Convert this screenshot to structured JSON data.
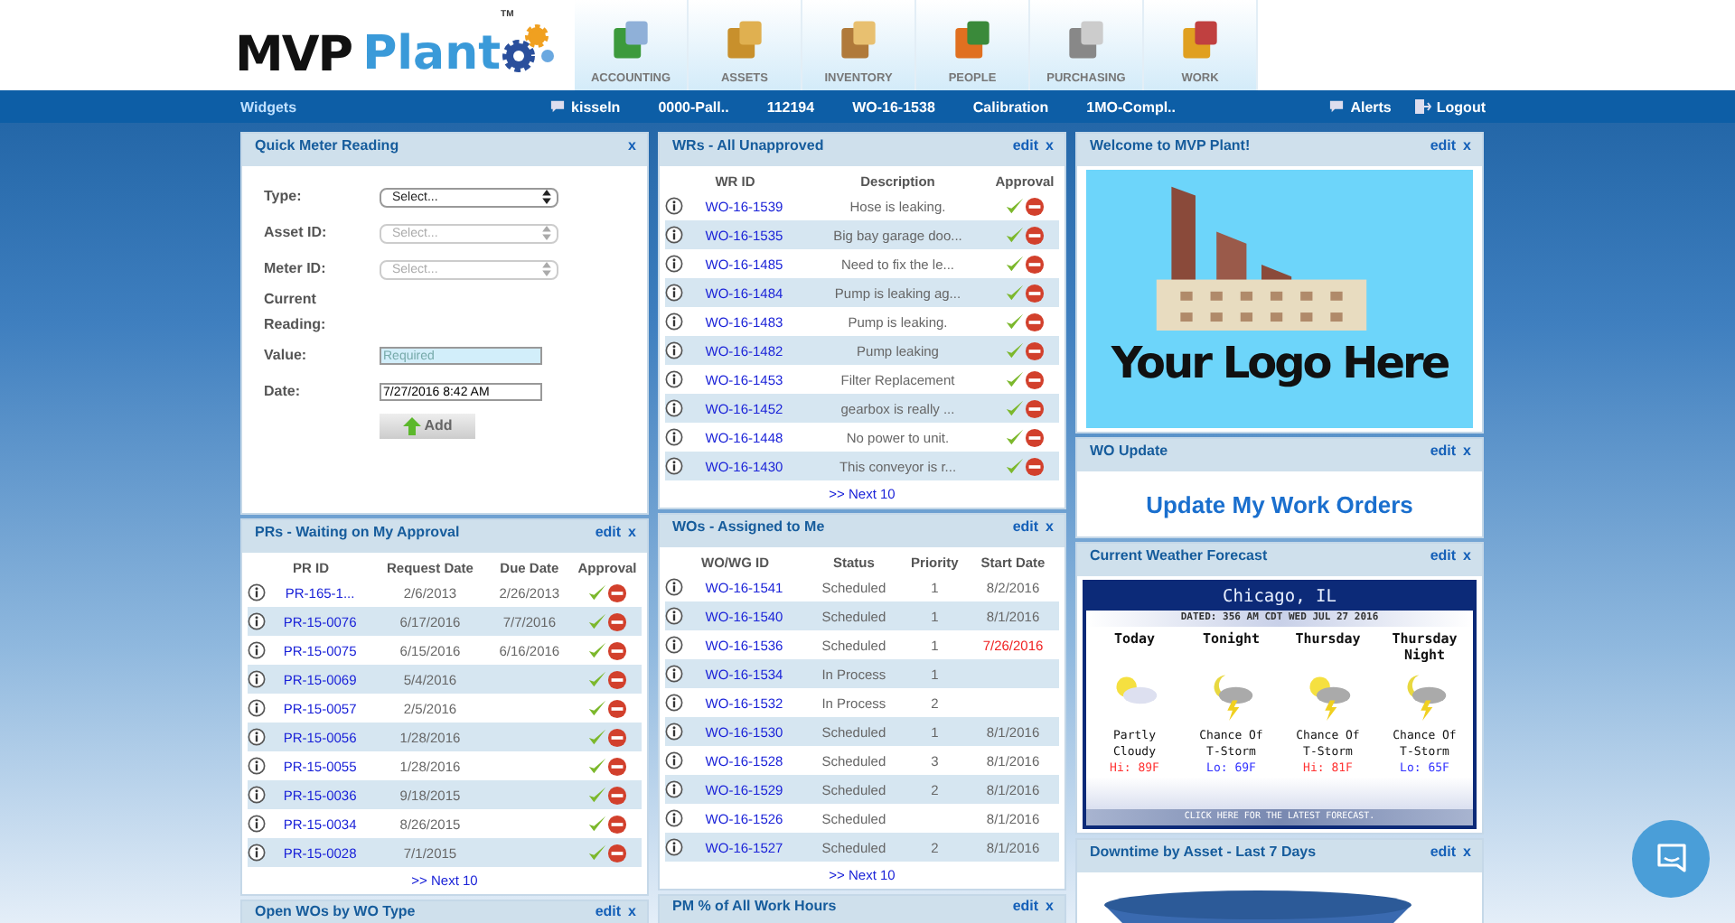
{
  "logo": {
    "word_1": "MVP",
    "word_2": "Plant",
    "tm": "TM"
  },
  "nav_tabs": [
    {
      "label": "ACCOUNTING"
    },
    {
      "label": "ASSETS"
    },
    {
      "label": "INVENTORY"
    },
    {
      "label": "PEOPLE"
    },
    {
      "label": "PURCHASING"
    },
    {
      "label": "WORK"
    }
  ],
  "toolbar": {
    "widgets": "Widgets",
    "user": "kisseln",
    "items": [
      "0000-Pall..",
      "112194",
      "WO-16-1538",
      "Calibration",
      "1MO-Compl.."
    ],
    "alerts": "Alerts",
    "logout": "Logout"
  },
  "columns": [
    [
      {
        "kind": "meter_form",
        "title": "Quick Meter Reading",
        "close": "x",
        "fields": [
          {
            "label": "Type:",
            "kind": "select",
            "value": "Select...",
            "disabled": false
          },
          {
            "label": "Asset ID:",
            "kind": "select",
            "value": "Select...",
            "disabled": true
          },
          {
            "label": "Meter ID:",
            "kind": "select",
            "value": "Select...",
            "disabled": true
          },
          {
            "label": "Current Reading:",
            "kind": "label"
          },
          {
            "label": "Value:",
            "kind": "input",
            "placeholder": "Required"
          },
          {
            "label": "Date:",
            "kind": "input",
            "value": "7/27/2016 8:42 AM"
          }
        ],
        "button": "Add"
      },
      {
        "kind": "approval_table",
        "title": "PRs - Waiting on My Approval",
        "edit": "edit",
        "close": "x",
        "columns": [
          "PR ID",
          "Request Date",
          "Due Date",
          "Approval"
        ],
        "rows": [
          {
            "cells": [
              "PR-165-1...",
              "2/6/2013",
              "2/26/2013"
            ]
          },
          {
            "cells": [
              "PR-15-0076",
              "6/17/2016",
              "7/7/2016"
            ]
          },
          {
            "cells": [
              "PR-15-0075",
              "6/15/2016",
              "6/16/2016"
            ]
          },
          {
            "cells": [
              "PR-15-0069",
              "5/4/2016",
              null
            ]
          },
          {
            "cells": [
              "PR-15-0057",
              "2/5/2016",
              null
            ]
          },
          {
            "cells": [
              "PR-15-0056",
              "1/28/2016",
              null
            ]
          },
          {
            "cells": [
              "PR-15-0055",
              "1/28/2016",
              null
            ]
          },
          {
            "cells": [
              "PR-15-0036",
              "9/18/2015",
              null
            ]
          },
          {
            "cells": [
              "PR-15-0034",
              "8/26/2015",
              null
            ]
          },
          {
            "cells": [
              "PR-15-0028",
              "7/1/2015",
              null
            ]
          }
        ],
        "next": ">> Next 10"
      },
      {
        "kind": "header",
        "title": "Open WOs by WO Type",
        "edit": "edit",
        "close": "x"
      }
    ],
    [
      {
        "kind": "approval_table",
        "title": "WRs - All Unapproved",
        "edit": "edit",
        "close": "x",
        "columns": [
          "WR ID",
          "Description",
          "Approval"
        ],
        "rows": [
          {
            "cells": [
              "WO-16-1539",
              "Hose is leaking."
            ]
          },
          {
            "cells": [
              "WO-16-1535",
              "Big bay garage doo..."
            ]
          },
          {
            "cells": [
              "WO-16-1485",
              "Need to fix the le..."
            ]
          },
          {
            "cells": [
              "WO-16-1484",
              "Pump is leaking ag..."
            ]
          },
          {
            "cells": [
              "WO-16-1483",
              "Pump is leaking."
            ]
          },
          {
            "cells": [
              "WO-16-1482",
              "Pump leaking"
            ]
          },
          {
            "cells": [
              "WO-16-1453",
              "Filter Replacement"
            ]
          },
          {
            "cells": [
              "WO-16-1452",
              "gearbox is really ..."
            ]
          },
          {
            "cells": [
              "WO-16-1448",
              "No power to unit."
            ]
          },
          {
            "cells": [
              "WO-16-1430",
              "This conveyor is r..."
            ]
          }
        ],
        "next": ">> Next 10"
      },
      {
        "kind": "table",
        "title": "WOs - Assigned to Me",
        "edit": "edit",
        "close": "x",
        "columns": [
          "WO/WG ID",
          "Status",
          "Priority",
          "Start Date"
        ],
        "rows": [
          {
            "cells": [
              "WO-16-1541",
              "Scheduled",
              "1",
              "8/2/2016"
            ],
            "overdue": false
          },
          {
            "cells": [
              "WO-16-1540",
              "Scheduled",
              "1",
              "8/1/2016"
            ],
            "overdue": false
          },
          {
            "cells": [
              "WO-16-1536",
              "Scheduled",
              "1",
              "7/26/2016"
            ],
            "overdue": true
          },
          {
            "cells": [
              "WO-16-1534",
              "In Process",
              "1",
              null
            ]
          },
          {
            "cells": [
              "WO-16-1532",
              "In Process",
              "2",
              null
            ]
          },
          {
            "cells": [
              "WO-16-1530",
              "Scheduled",
              "1",
              "8/1/2016"
            ],
            "overdue": false
          },
          {
            "cells": [
              "WO-16-1528",
              "Scheduled",
              "3",
              "8/1/2016"
            ],
            "overdue": false
          },
          {
            "cells": [
              "WO-16-1529",
              "Scheduled",
              "2",
              "8/1/2016"
            ],
            "overdue": false
          },
          {
            "cells": [
              "WO-16-1526",
              "Scheduled",
              null,
              "8/1/2016"
            ],
            "overdue": false
          },
          {
            "cells": [
              "WO-16-1527",
              "Scheduled",
              "2",
              "8/1/2016"
            ],
            "overdue": false
          }
        ],
        "next": ">> Next 10"
      },
      {
        "kind": "header",
        "title": "PM % of All Work Hours",
        "edit": "edit",
        "close": "x"
      }
    ],
    [
      {
        "kind": "logo",
        "title": "Welcome to MVP Plant!",
        "edit": "edit",
        "close": "x",
        "text": "Your Logo Here"
      },
      {
        "kind": "link",
        "title": "WO Update",
        "edit": "edit",
        "close": "x",
        "link": "Update My Work Orders"
      },
      {
        "kind": "weather",
        "title": "Current Weather Forecast",
        "edit": "edit",
        "close": "x",
        "city": "Chicago, IL",
        "dated": "DATED: 356 AM CDT WED JUL 27 2016",
        "days": [
          {
            "name": "Today",
            "kind": "cloudy",
            "condition": "Partly Cloudy",
            "temp": "Hi: 89F",
            "color": "#ff3333"
          },
          {
            "name": "Tonight",
            "kind": "nightstorm",
            "condition": "Chance Of T-Storm",
            "temp": "Lo: 69F",
            "color": "#3333ff"
          },
          {
            "name": "Thursday",
            "kind": "daystorm",
            "condition": "Chance Of T-Storm",
            "temp": "Hi: 81F",
            "color": "#ff3333"
          },
          {
            "name": "Thursday Night",
            "kind": "nightstorm",
            "condition": "Chance Of T-Storm",
            "temp": "Lo: 65F",
            "color": "#3333ff"
          }
        ],
        "footer": "CLICK HERE FOR THE LATEST FORECAST."
      },
      {
        "kind": "chart",
        "title": "Downtime by Asset - Last 7 Days",
        "edit": "edit",
        "close": "x"
      }
    ]
  ]
}
